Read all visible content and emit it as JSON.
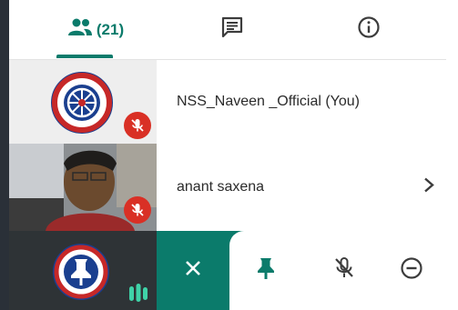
{
  "tabs": {
    "people_count": "(21)",
    "active": "people"
  },
  "participants": [
    {
      "name": "NSS_Naveen _Official (You)",
      "muted": true,
      "avatar": "nss-logo"
    },
    {
      "name": "anant saxena",
      "muted": true,
      "avatar": "camera-video"
    }
  ],
  "actions": {
    "icons": [
      "close-icon",
      "pin-icon",
      "mic-off-icon",
      "remove-icon"
    ]
  },
  "colors": {
    "accent": "#0b7b6b",
    "muted_badge": "#d93025",
    "nss_blue": "#1a3f8f",
    "nss_red": "#c62828"
  }
}
